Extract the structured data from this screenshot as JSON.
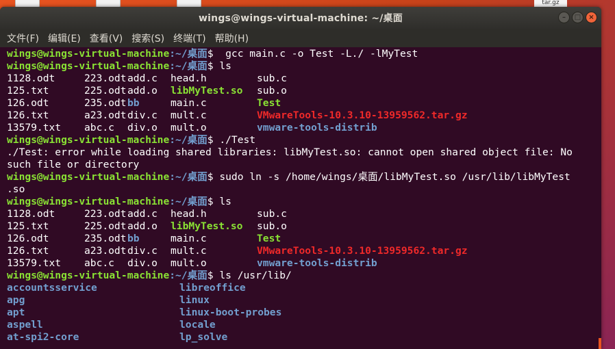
{
  "desktop": {
    "top_label": "tar.gz"
  },
  "window": {
    "title": "wings@wings-virtual-machine: ~/桌面",
    "buttons": {
      "minimize": "–",
      "maximize": "□",
      "close": "×"
    }
  },
  "menu": [
    "文件(F)",
    "编辑(E)",
    "查看(V)",
    "搜索(S)",
    "终端(T)",
    "帮助(H)"
  ],
  "colors": {
    "terminal_bg": "#300a24",
    "user": "#8ae234",
    "path": "#729fcf",
    "directory": "#729fcf",
    "shared_lib": "#8ae234",
    "executable": "#8ae234",
    "archive": "#ef2929",
    "text": "#ffffff"
  },
  "terminal": {
    "lines": [
      {
        "kind": "prompt",
        "user": "wings@wings-virtual-machine",
        "path": ":~/桌面",
        "sym": "$ ",
        "cmd": " gcc main.c -o Test -L./ -lMyTest"
      },
      {
        "kind": "prompt",
        "user": "wings@wings-virtual-machine",
        "path": ":~/桌面",
        "sym": "$ ",
        "cmd": "ls"
      },
      {
        "kind": "cols",
        "widths": [
          113,
          63,
          63,
          126,
          60
        ],
        "cells": [
          [
            "1128.odt",
            "file"
          ],
          [
            "223.odt",
            "file"
          ],
          [
            "add.c",
            "file"
          ],
          [
            "head.h",
            "file"
          ],
          [
            "sub.c",
            "file"
          ]
        ]
      },
      {
        "kind": "cols",
        "widths": [
          113,
          63,
          63,
          126,
          60
        ],
        "cells": [
          [
            "125.txt",
            "file"
          ],
          [
            "225.odt",
            "file"
          ],
          [
            "add.o",
            "file"
          ],
          [
            "libMyTest.so",
            "so"
          ],
          [
            "sub.o",
            "file"
          ]
        ]
      },
      {
        "kind": "cols",
        "widths": [
          113,
          63,
          63,
          126,
          60
        ],
        "cells": [
          [
            "126.odt",
            "file"
          ],
          [
            "235.odt",
            "file"
          ],
          [
            "bb",
            "dir"
          ],
          [
            "main.c",
            "file"
          ],
          [
            "Test",
            "exe"
          ]
        ]
      },
      {
        "kind": "cols",
        "widths": [
          113,
          63,
          63,
          126,
          60
        ],
        "cells": [
          [
            "126.txt",
            "file"
          ],
          [
            "a23.odt",
            "file"
          ],
          [
            "div.c",
            "file"
          ],
          [
            "mult.c",
            "file"
          ],
          [
            "VMwareTools-10.3.10-13959562.tar.gz",
            "arc"
          ]
        ]
      },
      {
        "kind": "cols",
        "widths": [
          113,
          63,
          63,
          126,
          60
        ],
        "cells": [
          [
            "13579.txt",
            "file"
          ],
          [
            "abc.c",
            "file"
          ],
          [
            "div.o",
            "file"
          ],
          [
            "mult.o",
            "file"
          ],
          [
            "vmware-tools-distrib",
            "dir"
          ]
        ]
      },
      {
        "kind": "prompt",
        "user": "wings@wings-virtual-machine",
        "path": ":~/桌面",
        "sym": "$ ",
        "cmd": "./Test"
      },
      {
        "kind": "text",
        "text": "./Test: error while loading shared libraries: libMyTest.so: cannot open shared object file: No"
      },
      {
        "kind": "text",
        "text": "such file or directory"
      },
      {
        "kind": "prompt",
        "user": "wings@wings-virtual-machine",
        "path": ":~/桌面",
        "sym": "$ ",
        "cmd": "sudo ln -s /home/wings/桌面/libMyTest.so /usr/lib/libMyTest"
      },
      {
        "kind": "text",
        "text": ".so"
      },
      {
        "kind": "prompt",
        "user": "wings@wings-virtual-machine",
        "path": ":~/桌面",
        "sym": "$ ",
        "cmd": "ls"
      },
      {
        "kind": "cols",
        "widths": [
          113,
          63,
          63,
          126,
          60
        ],
        "cells": [
          [
            "1128.odt",
            "file"
          ],
          [
            "223.odt",
            "file"
          ],
          [
            "add.c",
            "file"
          ],
          [
            "head.h",
            "file"
          ],
          [
            "sub.c",
            "file"
          ]
        ]
      },
      {
        "kind": "cols",
        "widths": [
          113,
          63,
          63,
          126,
          60
        ],
        "cells": [
          [
            "125.txt",
            "file"
          ],
          [
            "225.odt",
            "file"
          ],
          [
            "add.o",
            "file"
          ],
          [
            "libMyTest.so",
            "so"
          ],
          [
            "sub.o",
            "file"
          ]
        ]
      },
      {
        "kind": "cols",
        "widths": [
          113,
          63,
          63,
          126,
          60
        ],
        "cells": [
          [
            "126.odt",
            "file"
          ],
          [
            "235.odt",
            "file"
          ],
          [
            "bb",
            "dir"
          ],
          [
            "main.c",
            "file"
          ],
          [
            "Test",
            "exe"
          ]
        ]
      },
      {
        "kind": "cols",
        "widths": [
          113,
          63,
          63,
          126,
          60
        ],
        "cells": [
          [
            "126.txt",
            "file"
          ],
          [
            "a23.odt",
            "file"
          ],
          [
            "div.c",
            "file"
          ],
          [
            "mult.c",
            "file"
          ],
          [
            "VMwareTools-10.3.10-13959562.tar.gz",
            "arc"
          ]
        ]
      },
      {
        "kind": "cols",
        "widths": [
          113,
          63,
          63,
          126,
          60
        ],
        "cells": [
          [
            "13579.txt",
            "file"
          ],
          [
            "abc.c",
            "file"
          ],
          [
            "div.o",
            "file"
          ],
          [
            "mult.o",
            "file"
          ],
          [
            "vmware-tools-distrib",
            "dir"
          ]
        ]
      },
      {
        "kind": "prompt",
        "user": "wings@wings-virtual-machine",
        "path": ":~/桌面",
        "sym": "$ ",
        "cmd": "ls /usr/lib/"
      },
      {
        "kind": "cols",
        "widths": [
          252
        ],
        "cells": [
          [
            "accountsservice",
            "dir"
          ],
          [
            "libreoffice",
            "dir"
          ]
        ]
      },
      {
        "kind": "cols",
        "widths": [
          252
        ],
        "cells": [
          [
            "apg",
            "dir"
          ],
          [
            "linux",
            "dir"
          ]
        ]
      },
      {
        "kind": "cols",
        "widths": [
          252
        ],
        "cells": [
          [
            "apt",
            "dir"
          ],
          [
            "linux-boot-probes",
            "dir"
          ]
        ]
      },
      {
        "kind": "cols",
        "widths": [
          252
        ],
        "cells": [
          [
            "aspell",
            "dir"
          ],
          [
            "locale",
            "dir"
          ]
        ]
      },
      {
        "kind": "cols",
        "widths": [
          252
        ],
        "cells": [
          [
            "at-spi2-core",
            "dir"
          ],
          [
            "lp_solve",
            "dir"
          ]
        ]
      }
    ]
  }
}
